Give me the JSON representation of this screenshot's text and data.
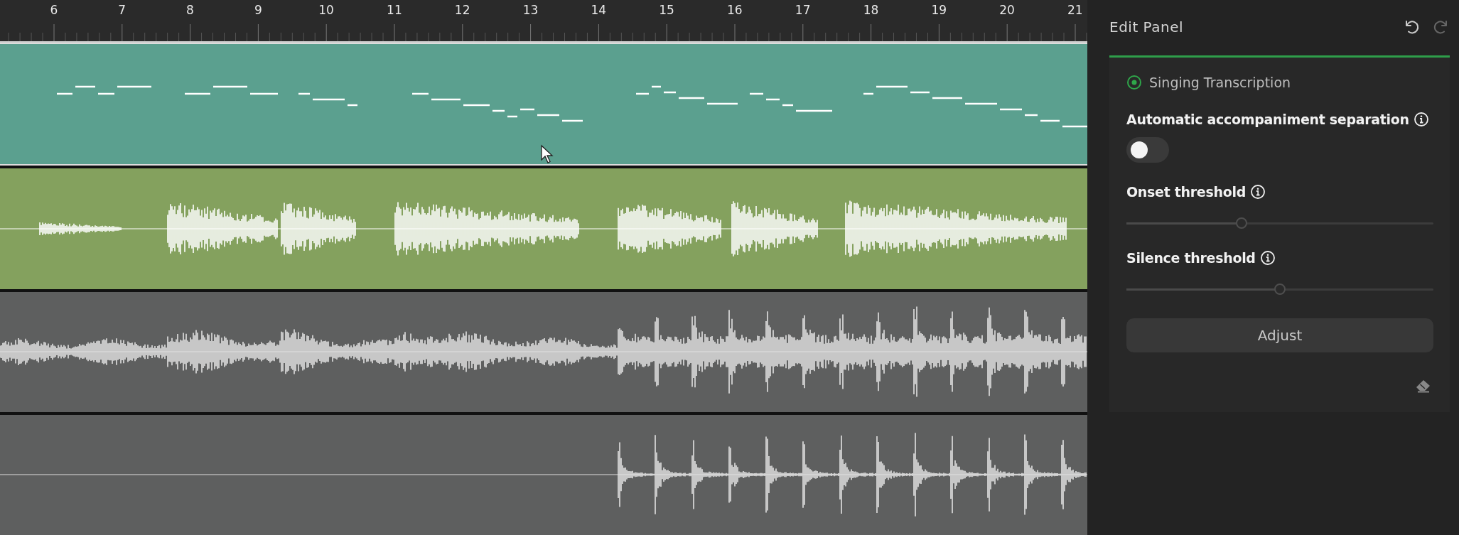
{
  "ruler": {
    "labels": [
      "6",
      "7",
      "8",
      "9",
      "10",
      "11",
      "12",
      "13",
      "14",
      "15",
      "16",
      "17",
      "18",
      "19",
      "20",
      "21"
    ]
  },
  "tracks": [
    {
      "kind": "notes",
      "color": "#5ba08f"
    },
    {
      "kind": "vocal",
      "color": "#84a15e"
    },
    {
      "kind": "mix",
      "color": "#5e5f5f"
    },
    {
      "kind": "drums",
      "color": "#5e5f5f"
    }
  ],
  "edit_panel": {
    "title": "Edit Panel",
    "undo": {
      "disabled": false
    },
    "redo": {
      "disabled": true
    },
    "mode": {
      "label": "Singing Transcription",
      "selected": true
    },
    "toggle": {
      "label": "Automatic accompaniment separation",
      "on": false
    },
    "sliders": [
      {
        "label": "Onset threshold",
        "level": 0.375
      },
      {
        "label": "Silence threshold",
        "level": 0.5
      }
    ],
    "button": "Adjust"
  }
}
